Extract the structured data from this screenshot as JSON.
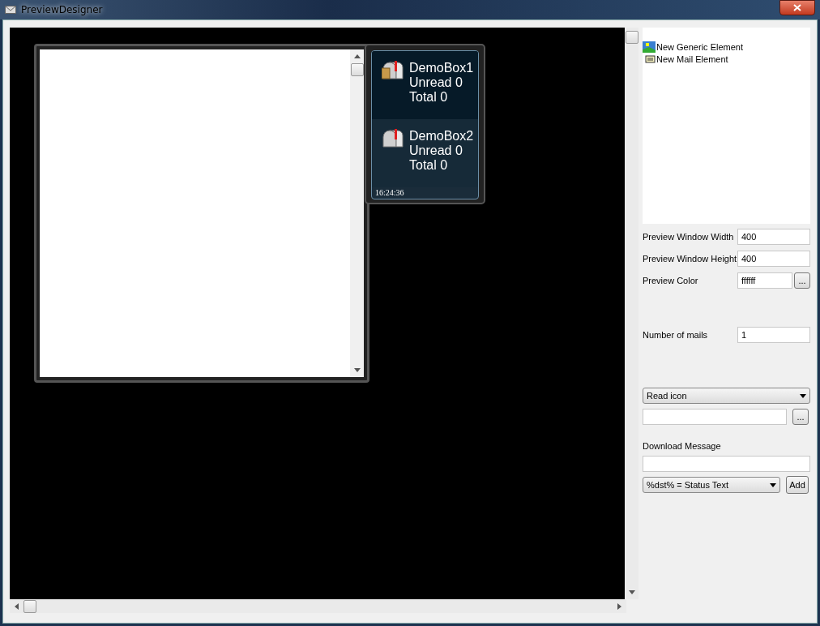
{
  "window": {
    "title": "PreviewDesigner"
  },
  "popup": {
    "mailboxes": [
      {
        "name": "DemoBox1",
        "unread": "Unread 0",
        "total": "Total 0",
        "selected": true,
        "kind": "letter"
      },
      {
        "name": "DemoBox2",
        "unread": "Unread 0",
        "total": "Total 0",
        "selected": false,
        "kind": "empty"
      }
    ],
    "time": "16:24:36"
  },
  "element_tree": {
    "items": [
      {
        "label": "New Generic Element",
        "kind": "generic"
      },
      {
        "label": "New Mail Element",
        "kind": "mail"
      }
    ]
  },
  "properties": [
    {
      "label": "Preview Window Width",
      "value": "400",
      "kind": "text"
    },
    {
      "label": "Preview Window Height",
      "value": "400",
      "kind": "text"
    },
    {
      "label": "Preview Color",
      "value": "ffffff",
      "kind": "browse",
      "button": "..."
    },
    {
      "label": "Number of mails",
      "value": "1",
      "kind": "text"
    }
  ],
  "icon_select": {
    "value": "Read icon"
  },
  "icon_path": {
    "button": "..."
  },
  "download_message": {
    "label": "Download Message"
  },
  "variable_select": {
    "value": "%dst% = Status Text"
  },
  "add_button": "Add"
}
